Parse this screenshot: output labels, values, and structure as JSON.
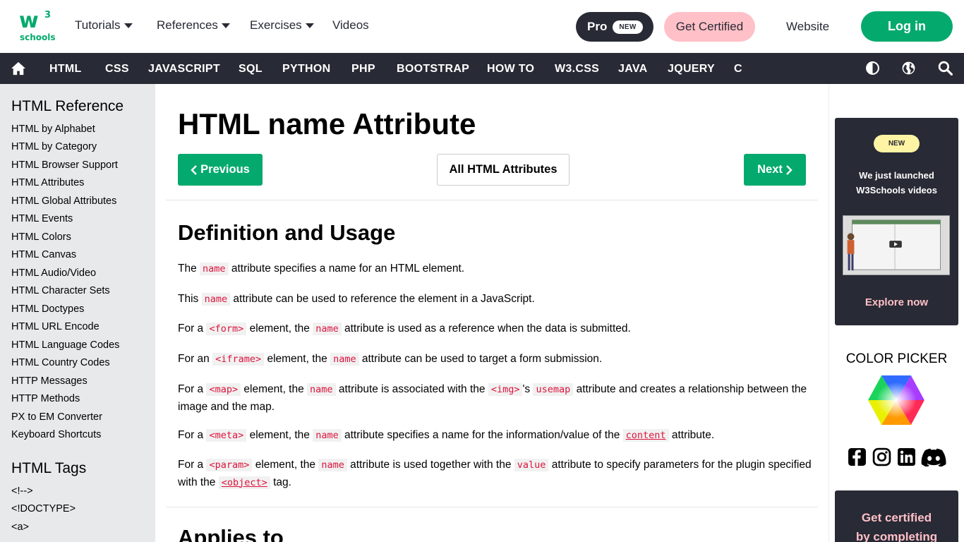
{
  "header": {
    "logo_text": "w",
    "logo_superscript": "3",
    "logo_subtext": "schools",
    "nav": [
      {
        "label": "Tutorials",
        "has_dropdown": true
      },
      {
        "label": "References",
        "has_dropdown": true
      },
      {
        "label": "Exercises",
        "has_dropdown": true
      },
      {
        "label": "Videos",
        "has_dropdown": false
      }
    ],
    "pro_label": "Pro",
    "pro_badge": "NEW",
    "certified_label": "Get Certified",
    "website_label": "Website",
    "login_label": "Log in"
  },
  "topnav": {
    "home_icon": "home-icon",
    "items": [
      "HTML",
      "CSS",
      "JAVASCRIPT",
      "SQL",
      "PYTHON",
      "PHP",
      "BOOTSTRAP",
      "HOW TO",
      "W3.CSS",
      "JAVA",
      "JQUERY",
      "C"
    ],
    "right_icons": [
      "contrast-icon",
      "globe-icon",
      "search-icon"
    ]
  },
  "sidebar": {
    "reference_heading": "HTML Reference",
    "reference_items": [
      "HTML by Alphabet",
      "HTML by Category",
      "HTML Browser Support",
      "HTML Attributes",
      "HTML Global Attributes",
      "HTML Events",
      "HTML Colors",
      "HTML Canvas",
      "HTML Audio/Video",
      "HTML Character Sets",
      "HTML Doctypes",
      "HTML URL Encode",
      "HTML Language Codes",
      "HTML Country Codes",
      "HTTP Messages",
      "HTTP Methods",
      "PX to EM Converter",
      "Keyboard Shortcuts"
    ],
    "tags_heading": "HTML Tags",
    "tag_items": [
      "<!-->",
      "<!DOCTYPE>",
      "<a>"
    ]
  },
  "main": {
    "title": "HTML name Attribute",
    "prev_label": "Previous",
    "all_label": "All HTML Attributes",
    "next_label": "Next",
    "definition_heading": "Definition and Usage",
    "paragraphs": [
      [
        {
          "t": "The "
        },
        {
          "c": "name"
        },
        {
          "t": " attribute specifies a name for an HTML element."
        }
      ],
      [
        {
          "t": "This "
        },
        {
          "c": "name"
        },
        {
          "t": " attribute can be used to reference the element in a JavaScript."
        }
      ],
      [
        {
          "t": "For a "
        },
        {
          "c": "<form>"
        },
        {
          "t": " element, the "
        },
        {
          "c": "name"
        },
        {
          "t": " attribute is  used as a reference when the data is submitted."
        }
      ],
      [
        {
          "t": "For an "
        },
        {
          "c": "<iframe>"
        },
        {
          "t": " element, the "
        },
        {
          "c": "name"
        },
        {
          "t": " attribute can be used to target a form submission."
        }
      ],
      [
        {
          "t": "For a "
        },
        {
          "c": "<map>"
        },
        {
          "t": " element, the "
        },
        {
          "c": "name"
        },
        {
          "t": " attribute is associated with the "
        },
        {
          "c": "<img>"
        },
        {
          "t": "'s "
        },
        {
          "c": "usemap"
        },
        {
          "t": " attribute and creates a relationship between the image and the map."
        }
      ],
      [
        {
          "t": "For a "
        },
        {
          "c": "<meta>"
        },
        {
          "t": " element, the "
        },
        {
          "c": "name"
        },
        {
          "t": " attribute specifies a name for the information/value of the "
        },
        {
          "l": "content"
        },
        {
          "t": " attribute."
        }
      ],
      [
        {
          "t": "For a "
        },
        {
          "c": "<param>"
        },
        {
          "t": " element, the "
        },
        {
          "c": "name"
        },
        {
          "t": " attribute is used together with the "
        },
        {
          "c": "value"
        },
        {
          "t": " attribute to specify parameters for the plugin specified with the "
        },
        {
          "l": "<object>"
        },
        {
          "t": " tag."
        }
      ]
    ],
    "applies_heading": "Applies to"
  },
  "right": {
    "ad_badge": "NEW",
    "ad_line1": "We just launched",
    "ad_line2": "W3Schools videos",
    "ad_cta": "Explore now",
    "color_picker_title": "COLOR PICKER",
    "social_icons": [
      "facebook-icon",
      "instagram-icon",
      "linkedin-icon",
      "discord-icon"
    ],
    "cert_line1": "Get certified",
    "cert_line2": "by completing"
  },
  "colors": {
    "brand_green": "#04AA6D",
    "dark": "#282A35",
    "pink": "#FFC0C7",
    "sidebar_bg": "#E7E9EB",
    "code_red": "#DC143C",
    "new_yellow": "#FFF4A3"
  }
}
